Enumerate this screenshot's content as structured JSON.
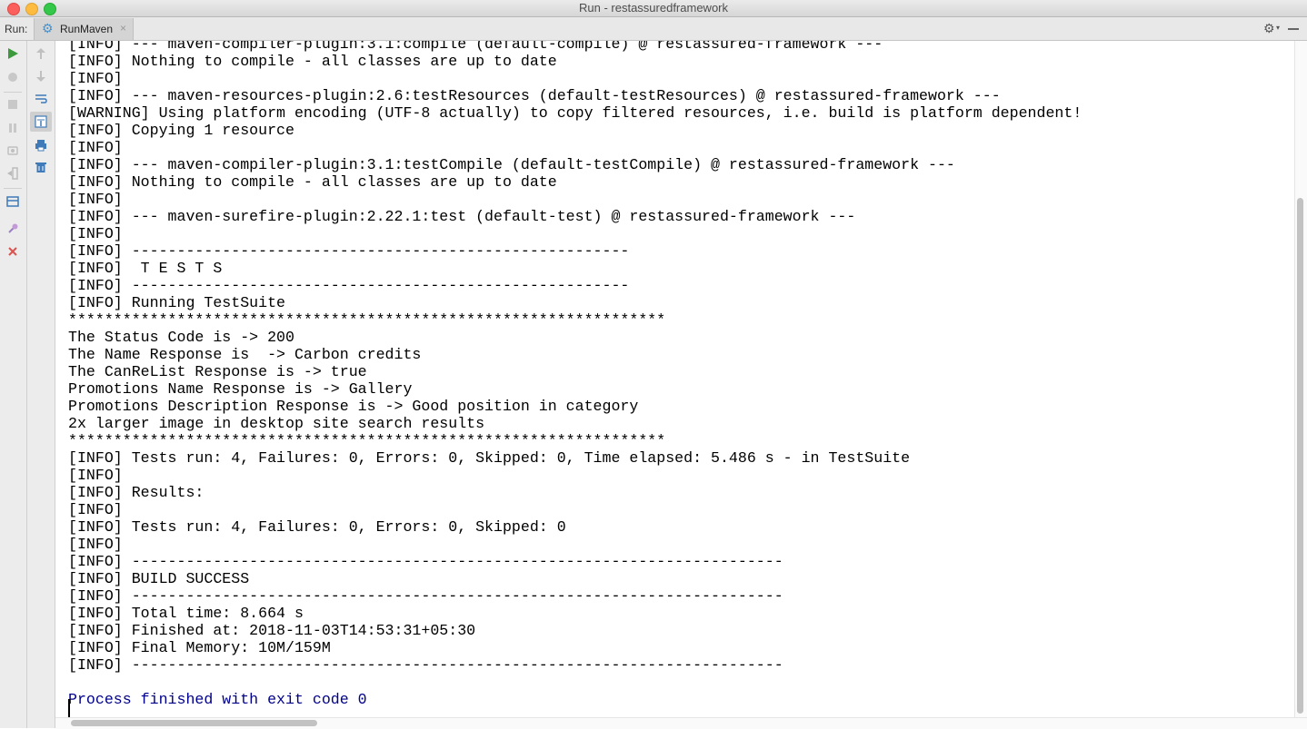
{
  "window": {
    "title": "Run - restassuredframework"
  },
  "run_panel": {
    "label": "Run:",
    "tab": {
      "label": "RunMaven",
      "icon": "maven-gear-icon",
      "close": "×"
    }
  },
  "colors": {
    "console_text": "#000000",
    "process_text": "#00008b",
    "rerun_green": "#3c9a3c",
    "close_red": "#d9534f",
    "tool_blue": "#3f7ab9"
  },
  "console": {
    "lines": [
      {
        "text": "[INFO] --- maven-compiler-plugin:3.1:compile (default-compile) @ restassured-framework ---",
        "style": "normal"
      },
      {
        "text": "[INFO] Nothing to compile - all classes are up to date",
        "style": "normal"
      },
      {
        "text": "[INFO]",
        "style": "normal"
      },
      {
        "text": "[INFO] --- maven-resources-plugin:2.6:testResources (default-testResources) @ restassured-framework ---",
        "style": "normal"
      },
      {
        "text": "[WARNING] Using platform encoding (UTF-8 actually) to copy filtered resources, i.e. build is platform dependent!",
        "style": "normal"
      },
      {
        "text": "[INFO] Copying 1 resource",
        "style": "normal"
      },
      {
        "text": "[INFO]",
        "style": "normal"
      },
      {
        "text": "[INFO] --- maven-compiler-plugin:3.1:testCompile (default-testCompile) @ restassured-framework ---",
        "style": "normal"
      },
      {
        "text": "[INFO] Nothing to compile - all classes are up to date",
        "style": "normal"
      },
      {
        "text": "[INFO]",
        "style": "normal"
      },
      {
        "text": "[INFO] --- maven-surefire-plugin:2.22.1:test (default-test) @ restassured-framework ---",
        "style": "normal"
      },
      {
        "text": "[INFO]",
        "style": "normal"
      },
      {
        "text": "[INFO] -------------------------------------------------------",
        "style": "normal"
      },
      {
        "text": "[INFO]  T E S T S",
        "style": "normal"
      },
      {
        "text": "[INFO] -------------------------------------------------------",
        "style": "normal"
      },
      {
        "text": "[INFO] Running TestSuite",
        "style": "normal"
      },
      {
        "text": "******************************************************************",
        "style": "normal"
      },
      {
        "text": "The Status Code is -> 200",
        "style": "normal"
      },
      {
        "text": "The Name Response is  -> Carbon credits",
        "style": "normal"
      },
      {
        "text": "The CanReList Response is -> true",
        "style": "normal"
      },
      {
        "text": "Promotions Name Response is -> Gallery",
        "style": "normal"
      },
      {
        "text": "Promotions Description Response is -> Good position in category",
        "style": "normal"
      },
      {
        "text": "2x larger image in desktop site search results",
        "style": "normal"
      },
      {
        "text": "******************************************************************",
        "style": "normal"
      },
      {
        "text": "[INFO] Tests run: 4, Failures: 0, Errors: 0, Skipped: 0, Time elapsed: 5.486 s - in TestSuite",
        "style": "normal"
      },
      {
        "text": "[INFO]",
        "style": "normal"
      },
      {
        "text": "[INFO] Results:",
        "style": "normal"
      },
      {
        "text": "[INFO]",
        "style": "normal"
      },
      {
        "text": "[INFO] Tests run: 4, Failures: 0, Errors: 0, Skipped: 0",
        "style": "normal"
      },
      {
        "text": "[INFO]",
        "style": "normal"
      },
      {
        "text": "[INFO] ------------------------------------------------------------------------",
        "style": "normal"
      },
      {
        "text": "[INFO] BUILD SUCCESS",
        "style": "normal"
      },
      {
        "text": "[INFO] ------------------------------------------------------------------------",
        "style": "normal"
      },
      {
        "text": "[INFO] Total time: 8.664 s",
        "style": "normal"
      },
      {
        "text": "[INFO] Finished at: 2018-11-03T14:53:31+05:30",
        "style": "normal"
      },
      {
        "text": "[INFO] Final Memory: 10M/159M",
        "style": "normal"
      },
      {
        "text": "[INFO] ------------------------------------------------------------------------",
        "style": "normal"
      },
      {
        "text": "",
        "style": "normal"
      },
      {
        "text": "Process finished with exit code 0",
        "style": "blue"
      }
    ]
  }
}
